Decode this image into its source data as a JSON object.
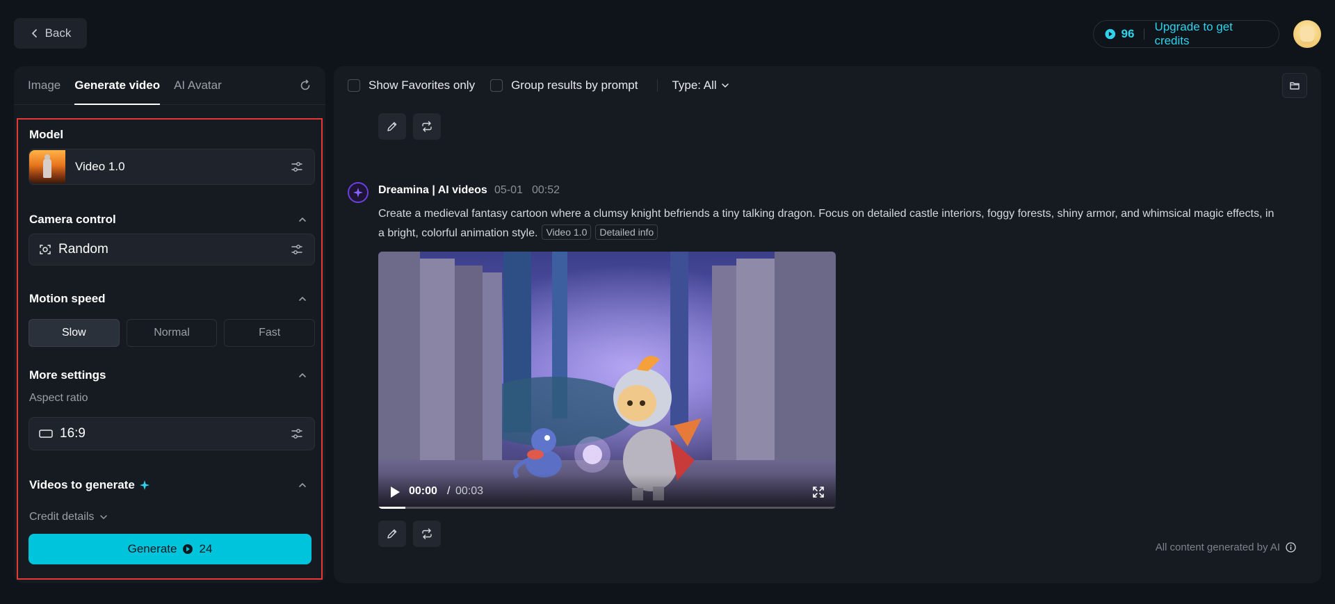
{
  "header": {
    "back_label": "Back",
    "credits": "96",
    "upgrade_label": "Upgrade to get credits"
  },
  "left_panel": {
    "tabs": [
      {
        "label": "Image",
        "active": false
      },
      {
        "label": "Generate video",
        "active": true
      },
      {
        "label": "AI Avatar",
        "active": false
      }
    ],
    "model": {
      "title": "Model",
      "value": "Video 1.0"
    },
    "camera_control": {
      "title": "Camera control",
      "value": "Random"
    },
    "motion_speed": {
      "title": "Motion speed",
      "options": [
        "Slow",
        "Normal",
        "Fast"
      ],
      "selected": "Slow"
    },
    "more_settings": {
      "title": "More settings",
      "aspect_ratio_label": "Aspect ratio",
      "aspect_ratio_value": "16:9"
    },
    "videos_to_generate": {
      "title": "Videos to generate"
    },
    "credit_details_label": "Credit details",
    "generate": {
      "label": "Generate",
      "cost": "24"
    }
  },
  "right_panel": {
    "toolbar": {
      "show_favorites_label": "Show Favorites only",
      "group_results_label": "Group results by prompt",
      "type_label": "Type: All"
    },
    "post": {
      "author": "Dreamina | AI videos",
      "date": "05-01",
      "time": "00:52",
      "prompt": "Create a medieval fantasy cartoon where a clumsy knight befriends a tiny talking dragon. Focus on detailed castle interiors, foggy forests, shiny armor, and whimsical magic effects, in a bright, colorful animation style.",
      "tags": [
        "Video 1.0",
        "Detailed info"
      ],
      "video": {
        "current_time": "00:00",
        "separator": "/",
        "total_time": "00:03",
        "progress": 0.06
      }
    },
    "footer_note": "All content generated by AI"
  },
  "colors": {
    "accent": "#00c4dc",
    "accent_text": "#2fd4ec",
    "background": "#0f131a",
    "panel": "#161a21",
    "highlight_border": "#e53935"
  }
}
